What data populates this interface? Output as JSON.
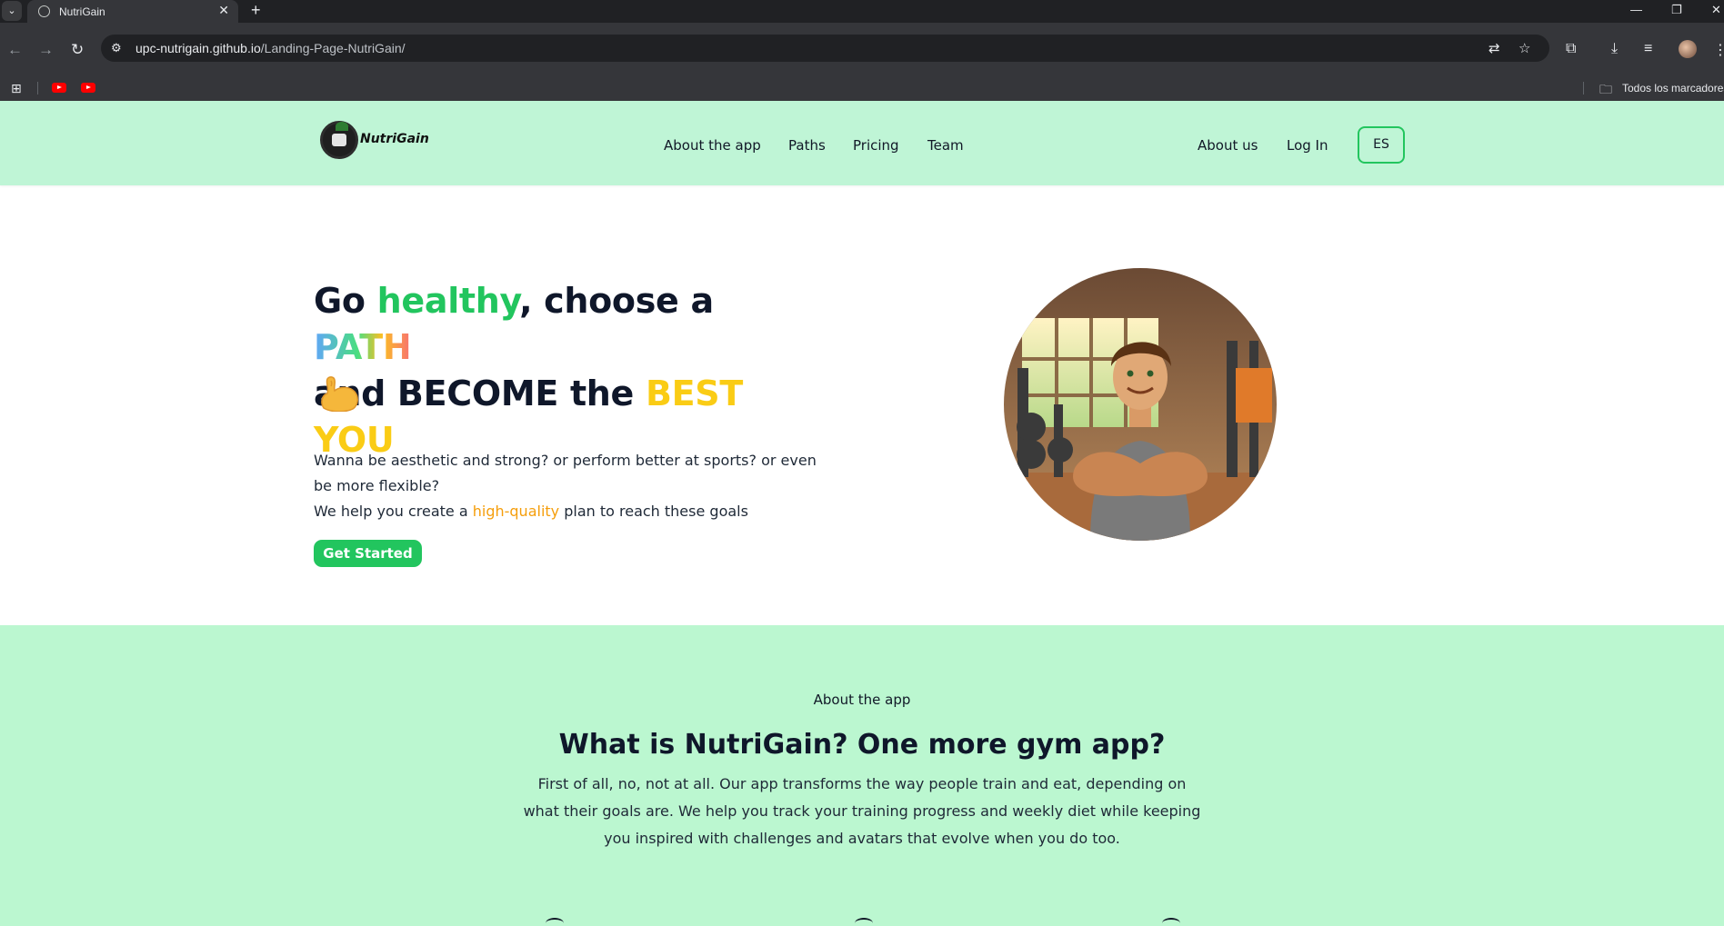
{
  "browser": {
    "tab_title": "NutriGain",
    "new_tab": "+",
    "url_host": "upc-nutrigain.github.io",
    "url_path": "/Landing-Page-NutriGain/",
    "bookmarks_folder": "Todos los marcadores"
  },
  "header": {
    "logo_text": "NutriGain",
    "nav": [
      "About the app",
      "Paths",
      "Pricing",
      "Team"
    ],
    "about_us": "About us",
    "login": "Log In",
    "lang": "ES"
  },
  "hero": {
    "title_part1": "Go ",
    "title_healthy": "healthy",
    "title_part2": ", choose a ",
    "title_path": "PATH",
    "title_part3": "and BECOME the ",
    "title_best": "BEST YOU",
    "desc_line1": "Wanna be aesthetic and strong? or perform better at sports? or even be more flexible?",
    "desc_line2_a": "We help you create a ",
    "desc_highlight": "high-quality",
    "desc_line2_b": " plan to reach these goals",
    "cta": "Get Started"
  },
  "about": {
    "kicker": "About the app",
    "title": "What is NutriGain? One more gym app?",
    "text": "First of all, no, not at all. Our app transforms the way people train and eat, depending on what their goals are. We help you track your training progress and weekly diet while keeping you inspired with challenges and avatars that evolve when you do too."
  }
}
